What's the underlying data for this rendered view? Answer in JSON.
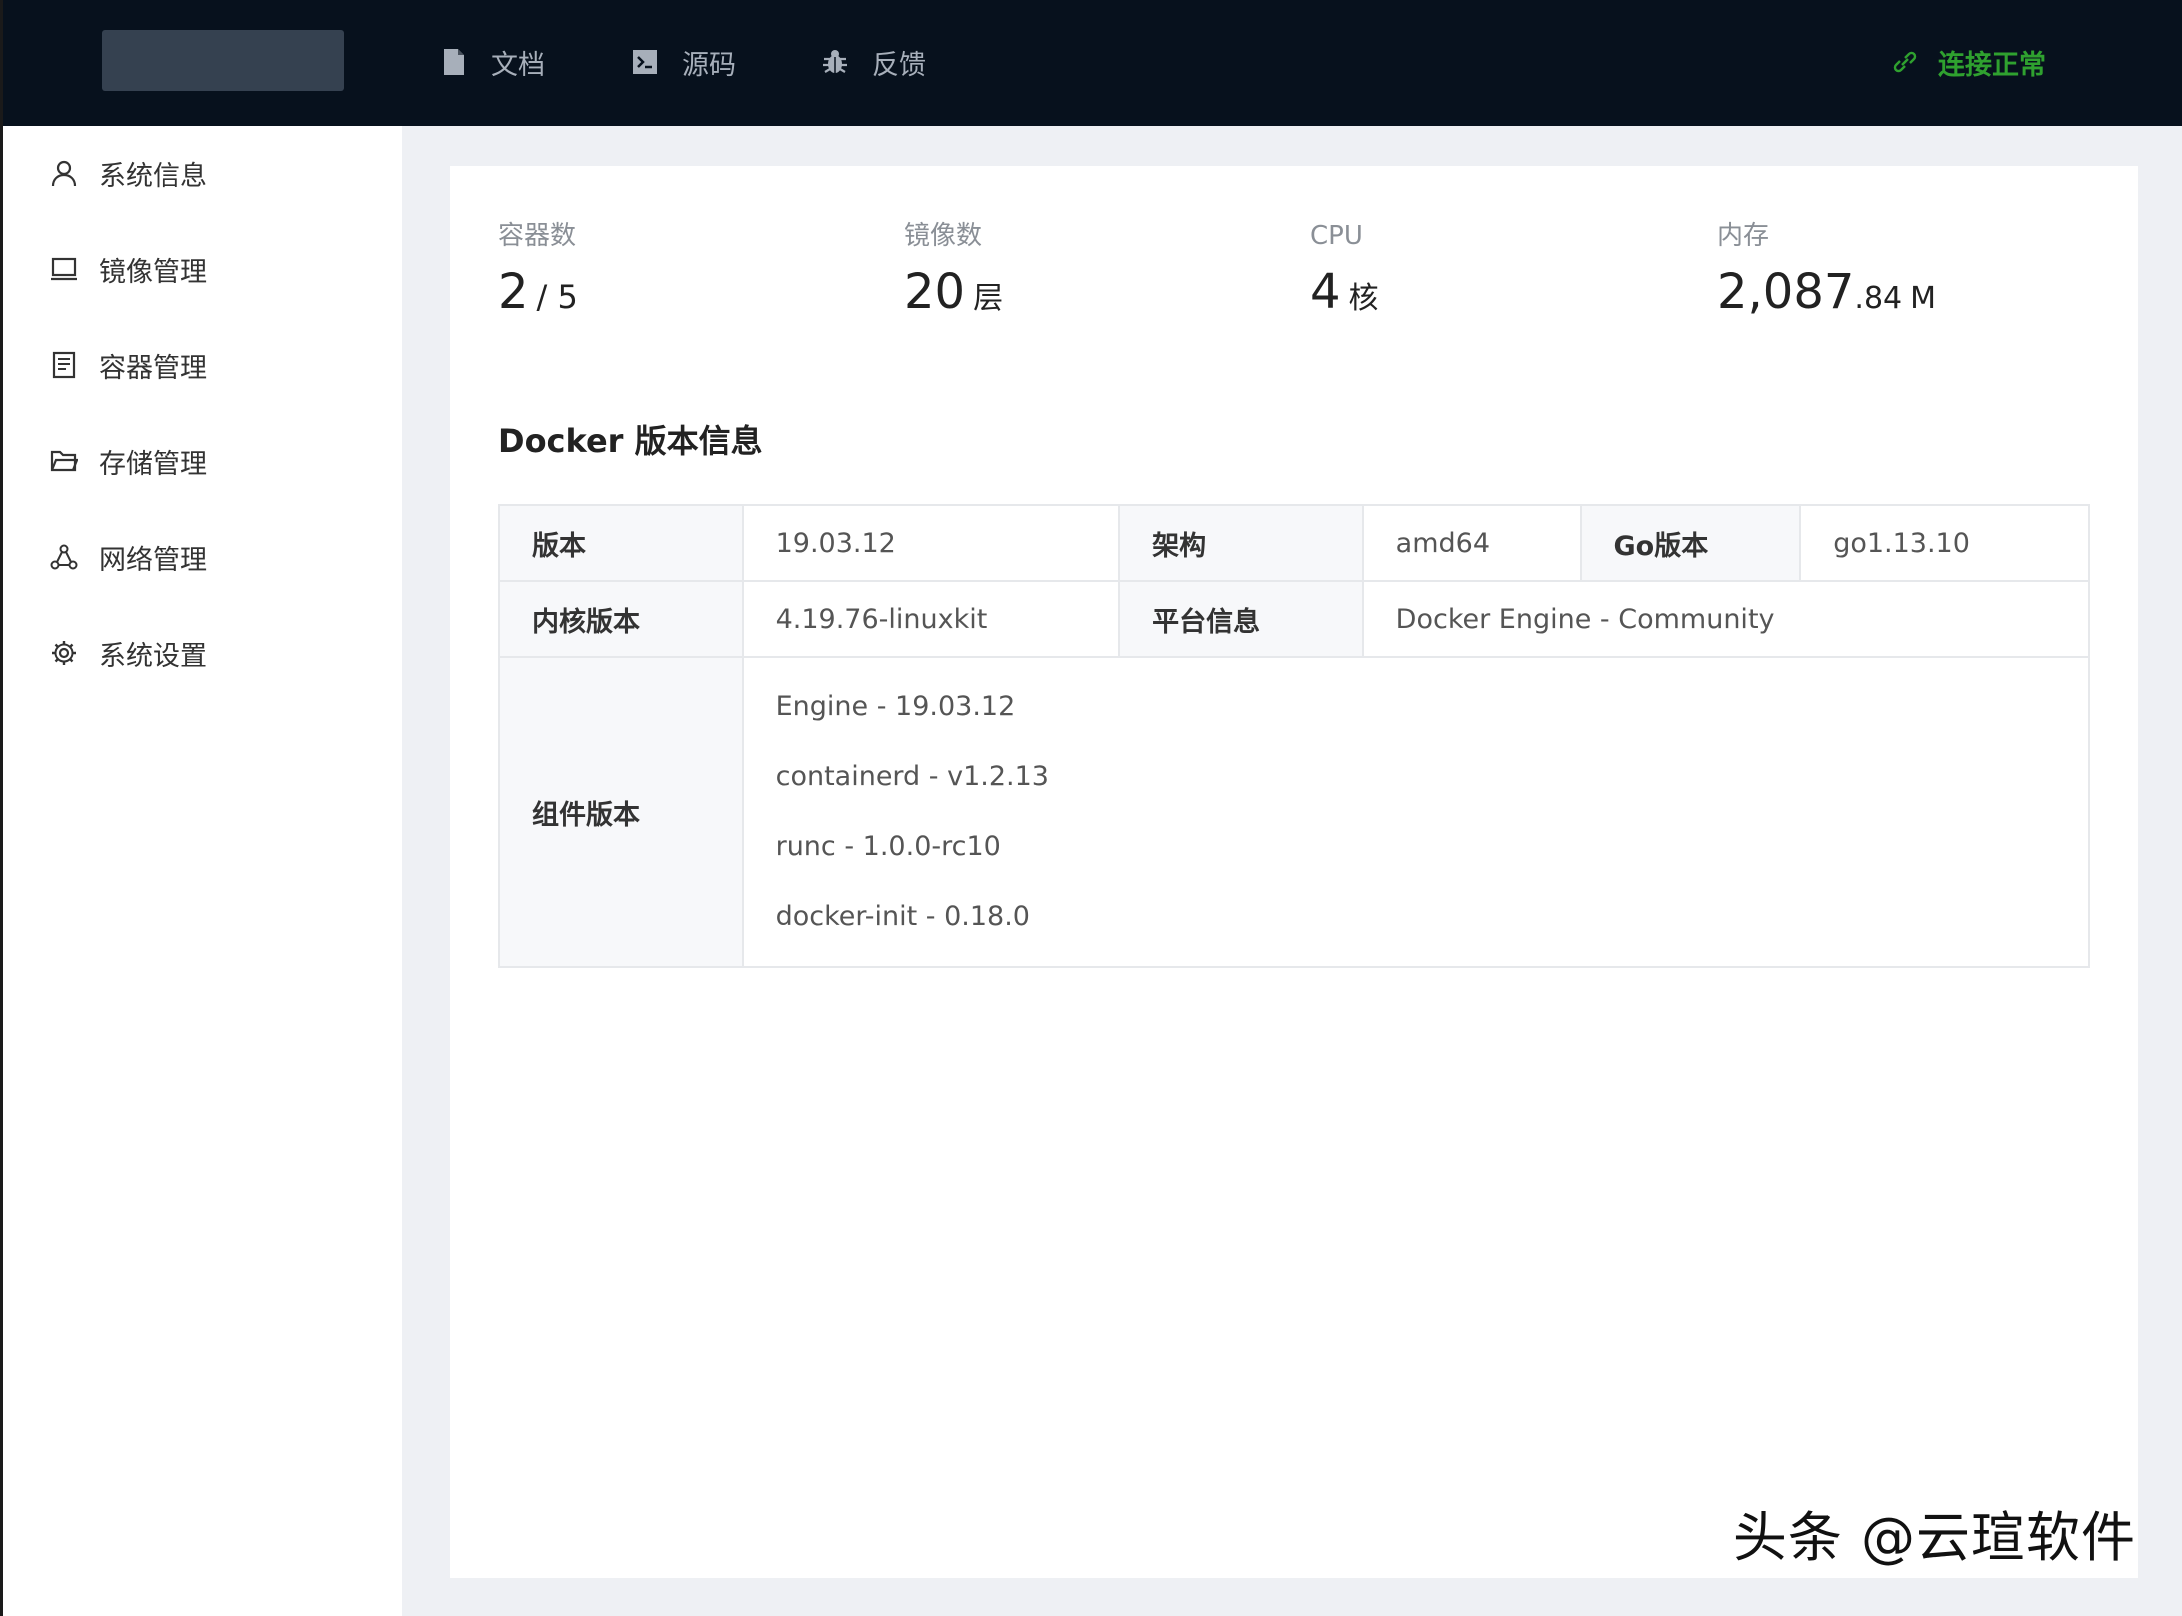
{
  "header": {
    "nav": [
      {
        "label": "文档",
        "icon": "document-icon"
      },
      {
        "label": "源码",
        "icon": "terminal-icon"
      },
      {
        "label": "反馈",
        "icon": "bug-icon"
      }
    ],
    "status": {
      "label": "连接正常",
      "icon": "link-icon",
      "color": "#2fa12f"
    }
  },
  "sidebar": {
    "items": [
      {
        "label": "系统信息",
        "icon": "user-icon"
      },
      {
        "label": "镜像管理",
        "icon": "laptop-icon"
      },
      {
        "label": "容器管理",
        "icon": "container-icon"
      },
      {
        "label": "存储管理",
        "icon": "folder-icon"
      },
      {
        "label": "网络管理",
        "icon": "network-icon"
      },
      {
        "label": "系统设置",
        "icon": "gear-icon"
      }
    ]
  },
  "stats": {
    "containers": {
      "label": "容器数",
      "value": "2",
      "suffix": "/ 5"
    },
    "images": {
      "label": "镜像数",
      "value": "20",
      "suffix": "层"
    },
    "cpu": {
      "label": "CPU",
      "value": "4",
      "suffix": "核"
    },
    "memory": {
      "label": "内存",
      "value": "2,087",
      "decimals": ".84",
      "suffix": "M"
    }
  },
  "docker": {
    "title": "Docker 版本信息",
    "version_label": "版本",
    "version": "19.03.12",
    "arch_label": "架构",
    "arch": "amd64",
    "go_label": "Go版本",
    "go": "go1.13.10",
    "kernel_label": "内核版本",
    "kernel": "4.19.76-linuxkit",
    "platform_label": "平台信息",
    "platform": "Docker Engine - Community",
    "components_label": "组件版本",
    "components": [
      "Engine - 19.03.12",
      "containerd - v1.2.13",
      "runc - 1.0.0-rc10",
      "docker-init - 0.18.0"
    ]
  },
  "watermark": "头条 @云瑄软件"
}
